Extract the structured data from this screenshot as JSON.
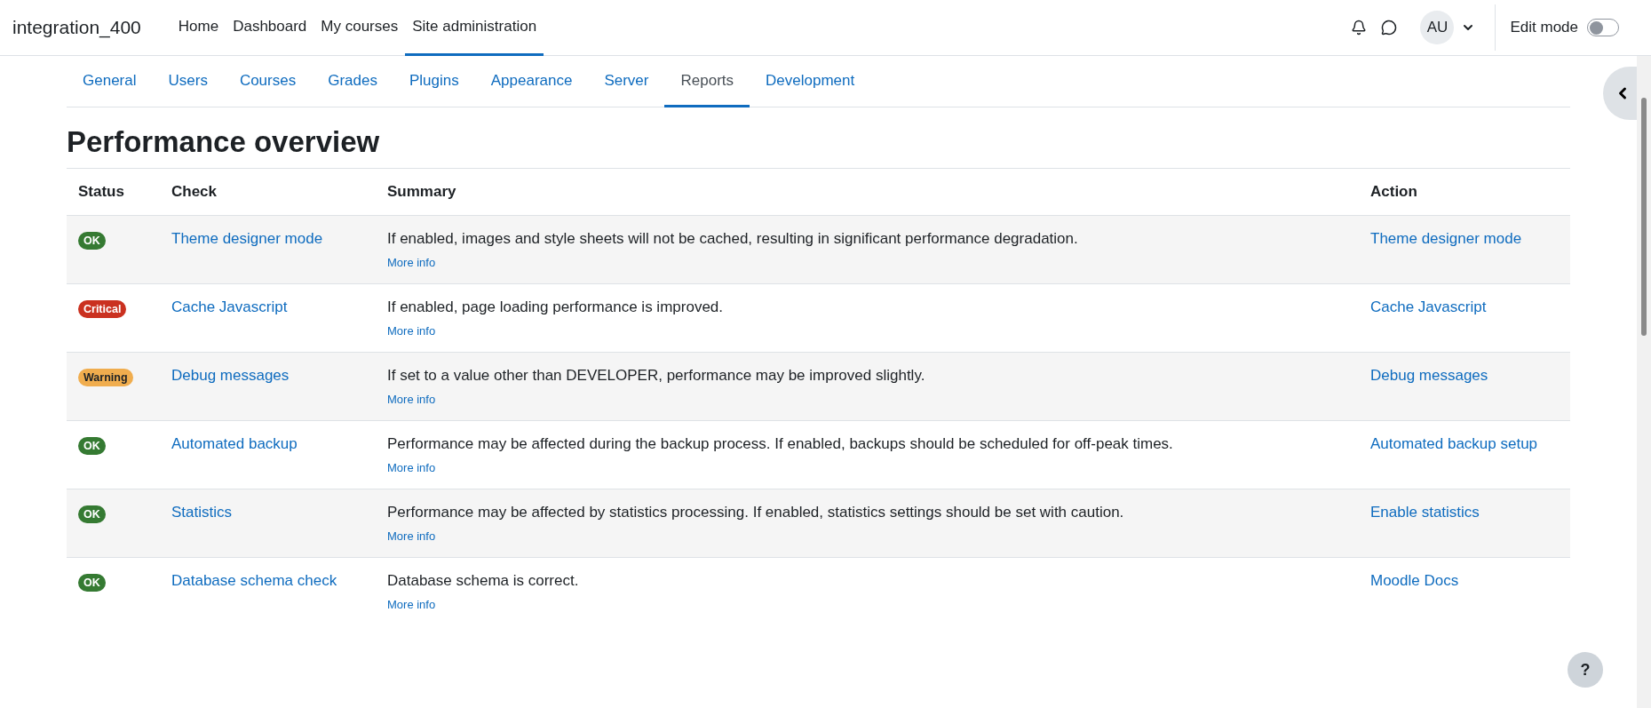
{
  "navbar": {
    "brand": "integration_400",
    "links": [
      {
        "label": "Home",
        "selected": false
      },
      {
        "label": "Dashboard",
        "selected": false
      },
      {
        "label": "My courses",
        "selected": false
      },
      {
        "label": "Site administration",
        "selected": true
      }
    ],
    "avatar": "AU",
    "edit_mode": {
      "label": "Edit mode",
      "on": false
    }
  },
  "tabs": [
    {
      "label": "General",
      "selected": false
    },
    {
      "label": "Users",
      "selected": false
    },
    {
      "label": "Courses",
      "selected": false
    },
    {
      "label": "Grades",
      "selected": false
    },
    {
      "label": "Plugins",
      "selected": false
    },
    {
      "label": "Appearance",
      "selected": false
    },
    {
      "label": "Server",
      "selected": false
    },
    {
      "label": "Reports",
      "selected": true
    },
    {
      "label": "Development",
      "selected": false
    }
  ],
  "page_title": "Performance overview",
  "table": {
    "columns": [
      "Status",
      "Check",
      "Summary",
      "Action"
    ],
    "rows": [
      {
        "status": {
          "label": "OK",
          "kind": "ok"
        },
        "check": "Theme designer mode",
        "summary": "If enabled, images and style sheets will not be cached, resulting in significant performance degradation.",
        "more": "More info",
        "action": "Theme designer mode"
      },
      {
        "status": {
          "label": "Critical",
          "kind": "critical"
        },
        "check": "Cache Javascript",
        "summary": "If enabled, page loading performance is improved.",
        "more": "More info",
        "action": "Cache Javascript"
      },
      {
        "status": {
          "label": "Warning",
          "kind": "warning"
        },
        "check": "Debug messages",
        "summary": "If set to a value other than DEVELOPER, performance may be improved slightly.",
        "more": "More info",
        "action": "Debug messages"
      },
      {
        "status": {
          "label": "OK",
          "kind": "ok"
        },
        "check": "Automated backup",
        "summary": "Performance may be affected during the backup process. If enabled, backups should be scheduled for off-peak times.",
        "more": "More info",
        "action": "Automated backup setup"
      },
      {
        "status": {
          "label": "OK",
          "kind": "ok"
        },
        "check": "Statistics",
        "summary": "Performance may be affected by statistics processing. If enabled, statistics settings should be set with caution.",
        "more": "More info",
        "action": "Enable statistics"
      },
      {
        "status": {
          "label": "OK",
          "kind": "ok"
        },
        "check": "Database schema check",
        "summary": "Database schema is correct.",
        "more": "More info",
        "action": "Moodle Docs"
      }
    ]
  },
  "help_button": "?"
}
